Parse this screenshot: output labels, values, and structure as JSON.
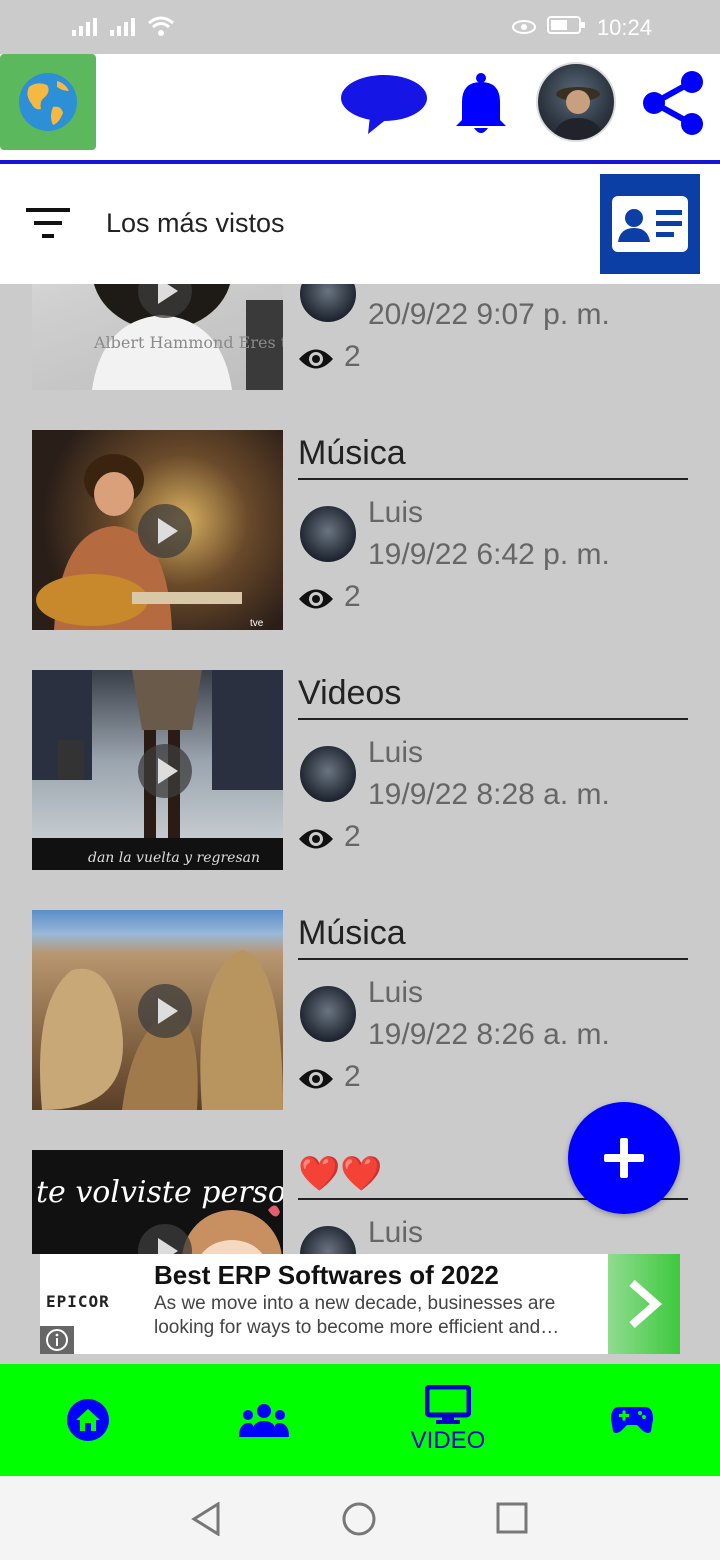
{
  "status_bar": {
    "time": "10:24"
  },
  "header": {
    "filter_label": "Los más vistos"
  },
  "videos": [
    {
      "category": "",
      "user": "",
      "date": "20/9/22 9:07 p. m.",
      "views": "2",
      "caption": "Albert Hammond Eres toda una mujer"
    },
    {
      "category": "Música",
      "user": "Luis",
      "date": "19/9/22 6:42 p. m.",
      "views": "2",
      "caption": "tve"
    },
    {
      "category": "Videos",
      "user": "Luis",
      "date": "19/9/22 8:28 a. m.",
      "views": "2",
      "caption": "dan la vuelta y regresan"
    },
    {
      "category": "Música",
      "user": "Luis",
      "date": "19/9/22 8:26 a. m.",
      "views": "2",
      "caption": ""
    },
    {
      "category": "❤️❤️",
      "user": "Luis",
      "date": "",
      "views": "",
      "caption": "te volviste persona"
    }
  ],
  "ad": {
    "brand": "EPICOR",
    "title": "Best ERP Softwares of 2022",
    "body": "As we move into a new decade, businesses are looking for ways to become more efficient and…"
  },
  "bottom_nav": {
    "video_label": "VIDEO"
  },
  "colors": {
    "accent": "#0000ff",
    "nav_bg": "#00ff00",
    "divider": "#1515d8"
  }
}
